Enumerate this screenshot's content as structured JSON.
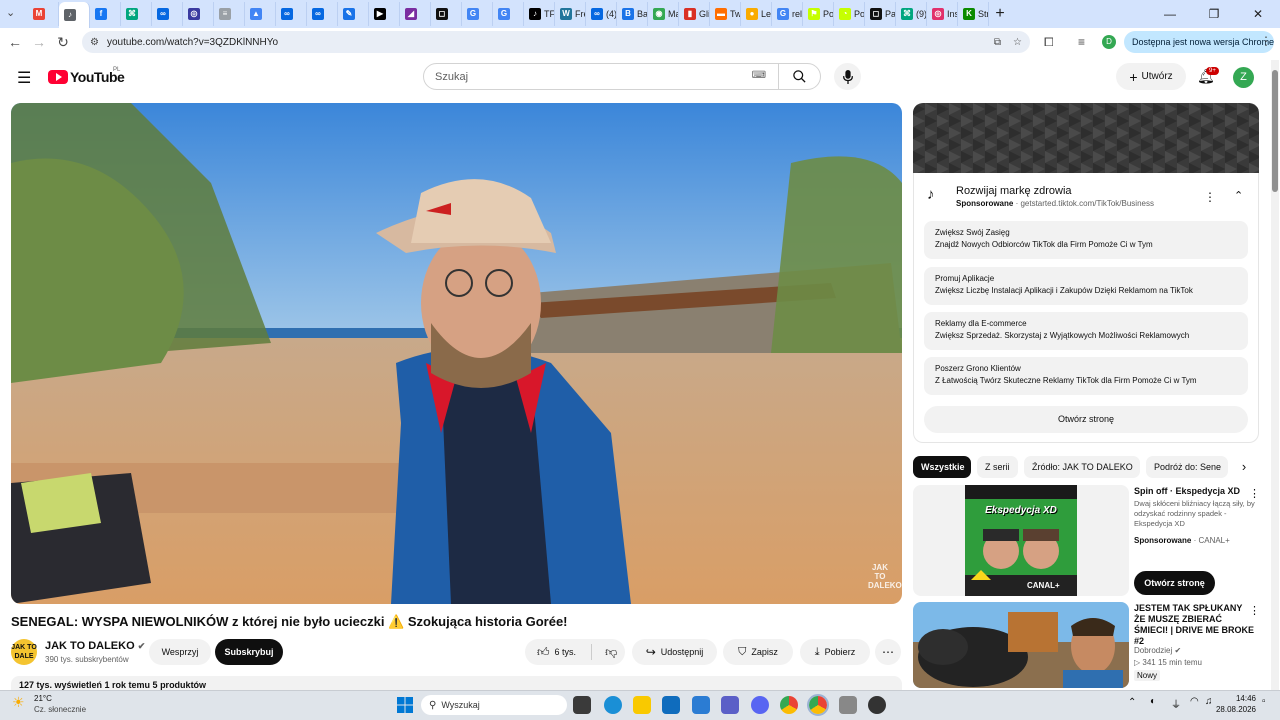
{
  "browser": {
    "tabs": [
      {
        "label": "",
        "color": "#ea4335",
        "glyph": "M"
      },
      {
        "label": "",
        "color": "#5f6368",
        "glyph": "♪",
        "active": true
      },
      {
        "label": "",
        "color": "#1877f2",
        "glyph": "f"
      },
      {
        "label": "",
        "color": "#00a67e",
        "glyph": "⌘"
      },
      {
        "label": "",
        "color": "#0668e1",
        "glyph": "∞"
      },
      {
        "label": "",
        "color": "#3a3aa0",
        "glyph": "◎"
      },
      {
        "label": "",
        "color": "#9aa0a6",
        "glyph": "≡"
      },
      {
        "label": "",
        "color": "#4285f4",
        "glyph": "▲"
      },
      {
        "label": "",
        "color": "#0668e1",
        "glyph": "∞"
      },
      {
        "label": "",
        "color": "#0668e1",
        "glyph": "∞"
      },
      {
        "label": "",
        "color": "#1a73e8",
        "glyph": "✎"
      },
      {
        "label": "",
        "color": "#000000",
        "glyph": "▶"
      },
      {
        "label": "",
        "color": "#7a2da0",
        "glyph": "◢"
      },
      {
        "label": "",
        "color": "#111111",
        "glyph": "◻"
      },
      {
        "label": "",
        "color": "#4285f4",
        "glyph": "G"
      },
      {
        "label": "",
        "color": "#4285f4",
        "glyph": "G"
      },
      {
        "label": "TF",
        "color": "#000000",
        "glyph": "♪"
      },
      {
        "label": "Fre",
        "color": "#21759b",
        "glyph": "W"
      },
      {
        "label": "(4)",
        "color": "#0668e1",
        "glyph": "∞"
      },
      {
        "label": "Ba",
        "color": "#1a73e8",
        "glyph": "B"
      },
      {
        "label": "Ma",
        "color": "#34a853",
        "glyph": "◉"
      },
      {
        "label": "Gli",
        "color": "#d93025",
        "glyph": "▮"
      },
      {
        "label": "Tw",
        "color": "#ff6d00",
        "glyph": "▬"
      },
      {
        "label": "Lel",
        "color": "#f9ab00",
        "glyph": "●"
      },
      {
        "label": "rel",
        "color": "#4285f4",
        "glyph": "G"
      },
      {
        "label": "Pol",
        "color": "#c6ff00",
        "glyph": "⚑"
      },
      {
        "label": "Po",
        "color": "#c6ff00",
        "glyph": "◔"
      },
      {
        "label": "Pa",
        "color": "#111111",
        "glyph": "◻"
      },
      {
        "label": "(9)",
        "color": "#00a67e",
        "glyph": "⌘"
      },
      {
        "label": "Ins",
        "color": "#e1306c",
        "glyph": "◎"
      },
      {
        "label": "Str",
        "color": "#0a8a00",
        "glyph": "K"
      }
    ],
    "url": "youtube.com/watch?v=3QZDKlNNHYo",
    "update_label": "Dostępna jest nowa wersja Chrome",
    "profile_initial": "D"
  },
  "yt": {
    "logo_text": "YouTube",
    "region": "PL",
    "search_placeholder": "Szukaj",
    "create_label": "Utwórz",
    "notif_count": "9+",
    "avatar_initial": "Z"
  },
  "video": {
    "title": "SENEGAL: WYSPA NIEWOLNIKÓW z której nie było ucieczki ⚠️ Szokująca historia Gorée!",
    "channel_name": "JAK TO DALEKO",
    "channel_avatar": "JAK TO DALE",
    "subscribers": "390 tys. subskrybentów",
    "support_label": "Wesprzyj",
    "subscribe_label": "Subskrybuj",
    "likes": "6 tys.",
    "share_label": "Udostępnij",
    "save_label": "Zapisz",
    "download_label": "Pobierz",
    "desc_summary": "127 tys. wyświetleń  1 rok temu  5 produktów",
    "watermark": "JAK TO DALEKO"
  },
  "ad": {
    "title": "Rozwijaj markę zdrowia",
    "sponsored": "Sponsorowane",
    "domain": "getstarted.tiktok.com/TikTok/Business",
    "items": [
      {
        "title": "Zwiększ Swój Zasięg",
        "desc": "Znajdź Nowych Odbiorców TikTok dla Firm Pomoże Ci w Tym"
      },
      {
        "title": "Promuj Aplikacje",
        "desc": "Zwiększ Liczbę Instalacji Aplikacji i Zakupów Dzięki Reklamom na TikTok"
      },
      {
        "title": "Reklamy dla E-commerce",
        "desc": "Zwiększ Sprzedaż. Skorzystaj z Wyjątkowych Możliwości Reklamowych"
      },
      {
        "title": "Poszerz Grono Klientów",
        "desc": "Z Łatwością Twórz Skuteczne Reklamy TikTok dla Firm Pomoże Ci w Tym"
      }
    ],
    "open_label": "Otwórz stronę"
  },
  "chips": [
    "Wszystkie",
    "Z serii",
    "Źródło: JAK TO DALEKO",
    "Podróż do: Sene"
  ],
  "recs": [
    {
      "title": "Spin off · Ekspedycja XD",
      "desc": "Dwaj skłóceni bliźniacy łączą siły, by odzyskać rodzinny spadek - Ekspedycja XD",
      "sponsored": "Sponsorowane",
      "advertiser": "CANAL+",
      "cta": "Otwórz stronę",
      "thumb_text": "Ekspedycja XD",
      "thumb_brand": "CANAL+"
    },
    {
      "title": "JESTEM TAK SPŁUKANY ŻE MUSZĘ ZBIERAĆ ŚMIECI! | DRIVE ME BROKE #2",
      "channel": "Dobrodziej",
      "stats": "341  15 min temu",
      "badge": "Nowy"
    }
  ],
  "taskbar": {
    "weather_temp": "21°C",
    "weather_desc": "Cz. słonecznie",
    "search_placeholder": "Wyszukaj",
    "time": "14:46",
    "date": "28.08.2026"
  }
}
